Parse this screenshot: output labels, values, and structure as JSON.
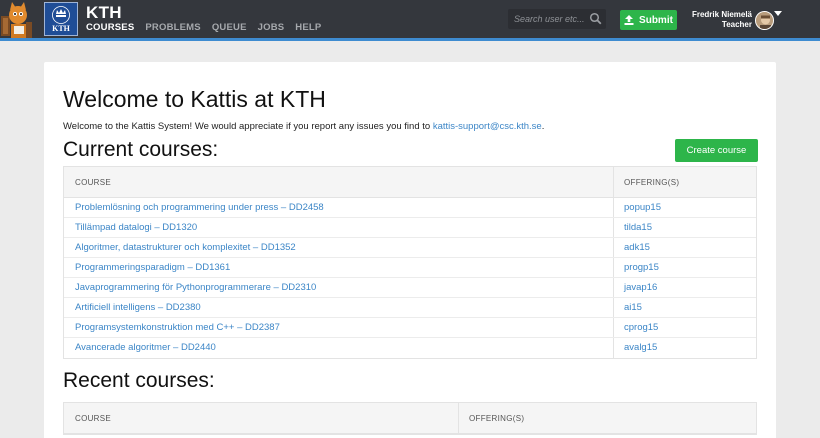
{
  "header": {
    "brand": "KTH",
    "logo_text": "KTH",
    "nav": [
      {
        "label": "COURSES",
        "active": true
      },
      {
        "label": "PROBLEMS",
        "active": false
      },
      {
        "label": "QUEUE",
        "active": false
      },
      {
        "label": "JOBS",
        "active": false
      },
      {
        "label": "HELP",
        "active": false
      }
    ],
    "search_placeholder": "Search user etc...",
    "submit_label": "Submit",
    "user_name": "Fredrik Niemelä",
    "user_role": "Teacher"
  },
  "colors": {
    "nav_bg": "#34373d",
    "accent": "#3e8bd0",
    "green": "#2db54a",
    "link": "#3c86c7"
  },
  "main": {
    "title": "Welcome to Kattis at KTH",
    "intro_text": "Welcome to the Kattis System! We would appreciate if you report any issues you find to ",
    "intro_link": "kattis-support@csc.kth.se",
    "intro_end": ".",
    "current_title": "Current courses:",
    "create_course_label": "Create course",
    "current_table": {
      "headers": [
        "COURSE",
        "OFFERING(S)"
      ],
      "rows": [
        {
          "course": "Problemlösning och programmering under press – DD2458",
          "offering": "popup15"
        },
        {
          "course": "Tillämpad datalogi – DD1320",
          "offering": "tilda15"
        },
        {
          "course": "Algoritmer, datastrukturer och komplexitet – DD1352",
          "offering": "adk15"
        },
        {
          "course": "Programmeringsparadigm – DD1361",
          "offering": "progp15"
        },
        {
          "course": "Javaprogrammering för Pythonprogrammerare – DD2310",
          "offering": "javap16"
        },
        {
          "course": "Artificiell intelligens – DD2380",
          "offering": "ai15"
        },
        {
          "course": "Programsystemkonstruktion med C++ – DD2387",
          "offering": "cprog15"
        },
        {
          "course": "Avancerade algoritmer – DD2440",
          "offering": "avalg15"
        }
      ]
    },
    "recent_title": "Recent courses:",
    "recent_table": {
      "headers": [
        "COURSE",
        "OFFERING(S)"
      ]
    }
  }
}
